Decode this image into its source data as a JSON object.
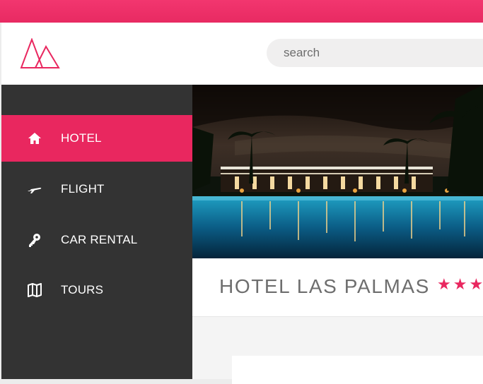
{
  "search": {
    "placeholder": "search"
  },
  "nav": {
    "items": [
      {
        "label": "HOTEL",
        "icon": "home-icon",
        "active": true
      },
      {
        "label": "FLIGHT",
        "icon": "plane-icon",
        "active": false
      },
      {
        "label": "CAR RENTAL",
        "icon": "key-icon",
        "active": false
      },
      {
        "label": "TOURS",
        "icon": "map-icon",
        "active": false
      }
    ]
  },
  "hotel": {
    "name": "HOTEL LAS PALMAS",
    "stars_visible": "★★★"
  },
  "colors": {
    "accent": "#e9275f",
    "sidebar": "#333333",
    "header": "#ffffff"
  }
}
